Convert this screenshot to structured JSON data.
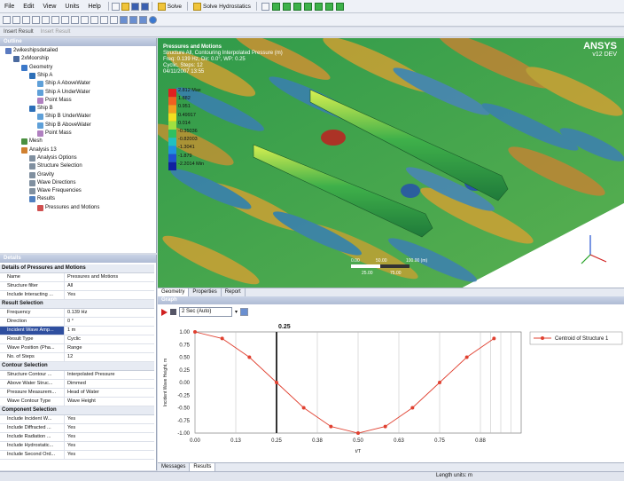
{
  "menu": {
    "items": [
      "File",
      "Edit",
      "View",
      "Units",
      "Help"
    ],
    "solve_label": "Solve",
    "solve_hydro_label": "Solve Hydrostatics"
  },
  "toolbar3": {
    "insert_result": "Insert Result",
    "insert_result2": "Insert Result"
  },
  "outline": {
    "title": "Outline",
    "items": [
      {
        "label": "2wikeshipsdetailed",
        "indent": 0,
        "color": "#5a7ac0"
      },
      {
        "label": "2xMoorship",
        "indent": 1,
        "color": "#4a6a9f"
      },
      {
        "label": "Geometry",
        "indent": 2,
        "color": "#3b78c9"
      },
      {
        "label": "Ship A",
        "indent": 3,
        "color": "#2c6fb8"
      },
      {
        "label": "Ship A AboveWater",
        "indent": 4,
        "color": "#5fa0d8"
      },
      {
        "label": "Ship A UnderWater",
        "indent": 4,
        "color": "#5fa0d8"
      },
      {
        "label": "Point Mass",
        "indent": 4,
        "color": "#b080c0"
      },
      {
        "label": "Ship B",
        "indent": 3,
        "color": "#2c6fb8"
      },
      {
        "label": "Ship B UnderWater",
        "indent": 4,
        "color": "#5fa0d8"
      },
      {
        "label": "Ship B AboveWater",
        "indent": 4,
        "color": "#5fa0d8"
      },
      {
        "label": "Point Mass",
        "indent": 4,
        "color": "#b080c0"
      },
      {
        "label": "Mesh",
        "indent": 2,
        "color": "#4a9040"
      },
      {
        "label": "Analysis 13",
        "indent": 2,
        "color": "#d08030"
      },
      {
        "label": "Analysis Options",
        "indent": 3,
        "color": "#8090a0"
      },
      {
        "label": "Structure Selection",
        "indent": 3,
        "color": "#8090a0"
      },
      {
        "label": "Gravity",
        "indent": 3,
        "color": "#8090a0"
      },
      {
        "label": "Wave Directions",
        "indent": 3,
        "color": "#8090a0"
      },
      {
        "label": "Wave Frequencies",
        "indent": 3,
        "color": "#8090a0"
      },
      {
        "label": "Results",
        "indent": 3,
        "color": "#5080c0"
      },
      {
        "label": "Pressures and Motions",
        "indent": 4,
        "color": "#d05050"
      }
    ]
  },
  "details": {
    "title": "Details",
    "sections": [
      {
        "title": "Details of Pressures and Motions",
        "rows": [
          {
            "k": "Name",
            "v": "Pressures and Motions"
          },
          {
            "k": "Structure filter",
            "v": "All"
          },
          {
            "k": "Include Interacting ...",
            "v": "Yes"
          }
        ]
      },
      {
        "title": "Result Selection",
        "rows": [
          {
            "k": "Frequency",
            "v": "0.139 Hz"
          },
          {
            "k": "Direction",
            "v": "0 °"
          },
          {
            "k": "Incident Wave Amp...",
            "v": "1 m",
            "sel": true
          },
          {
            "k": "Result Type",
            "v": "Cyclic"
          },
          {
            "k": "Wave Position (Pha...",
            "v": "Range"
          },
          {
            "k": "No. of Steps",
            "v": "12"
          }
        ]
      },
      {
        "title": "Contour Selection",
        "rows": [
          {
            "k": "Structure Contour ...",
            "v": "Interpolated Pressure"
          },
          {
            "k": "Above Water Struc...",
            "v": "Dimmed"
          },
          {
            "k": "Pressure Measurem...",
            "v": "Head of Water"
          },
          {
            "k": "Wave Contour Type",
            "v": "Wave Height"
          }
        ]
      },
      {
        "title": "Component Selection",
        "rows": [
          {
            "k": "Include Incident W...",
            "v": "Yes"
          },
          {
            "k": "Include Diffracted ...",
            "v": "Yes"
          },
          {
            "k": "Include Radiation ...",
            "v": "Yes"
          },
          {
            "k": "Include Hydrostatic...",
            "v": "Yes"
          },
          {
            "k": "Include Second Ord...",
            "v": "Yes"
          }
        ]
      }
    ]
  },
  "viewport": {
    "header_lines": [
      "Pressures and Motions",
      "Structure All, Contouring Interpolated Pressure (m)",
      "Freq: 0.139 Hz, Dir: 0.0°, WP: 0.25",
      "Cyclic, Steps: 12",
      "04/11/2007 13:55"
    ],
    "brand": "ANSYS",
    "brand_sub": "v12 DEV",
    "legend": [
      "2.812 Max",
      "1.882",
      "0.951",
      "0.49917",
      "0.014",
      "-0.35036",
      "-0.82003",
      "-1.3041",
      "-1.879",
      "-2.2014 Min"
    ],
    "scale_labels": [
      "0.00",
      "50.00",
      "100.00 (m)",
      "25.00",
      "75.00"
    ],
    "tabs": [
      "Geometry",
      "Properties",
      "Report"
    ]
  },
  "graph": {
    "title": "Graph",
    "dropdown": "2 Sec (Auto)",
    "tabs": [
      "Messages",
      "Results"
    ],
    "cursor_label": "0.25"
  },
  "chart_data": {
    "type": "line",
    "title": "",
    "xlabel": "t/T",
    "ylabel": "Incident Wave Height, m",
    "xlim": [
      0,
      1
    ],
    "ylim": [
      -1,
      1
    ],
    "x_ticks": [
      "0.00",
      "0.13",
      "0.25",
      "0.38",
      "0.50",
      "0.63",
      "0.75",
      "0.88"
    ],
    "y_ticks": [
      "1.00",
      "0.75",
      "0.50",
      "0.25",
      "0.00",
      "-0.25",
      "-0.50",
      "-0.75",
      "-1.00"
    ],
    "series": [
      {
        "name": "Centroid of Structure 1",
        "color": "#e04030",
        "x": [
          0.0,
          0.0833,
          0.1667,
          0.25,
          0.3333,
          0.4167,
          0.5,
          0.5833,
          0.6667,
          0.75,
          0.8333,
          0.9167
        ],
        "y": [
          1.0,
          0.87,
          0.5,
          0.0,
          -0.5,
          -0.87,
          -1.0,
          -0.87,
          -0.5,
          0.0,
          0.5,
          0.87
        ]
      }
    ],
    "cursor_x": 0.25,
    "legend_position": "top-right",
    "grid": true
  },
  "status": {
    "units": "Length units: m"
  }
}
